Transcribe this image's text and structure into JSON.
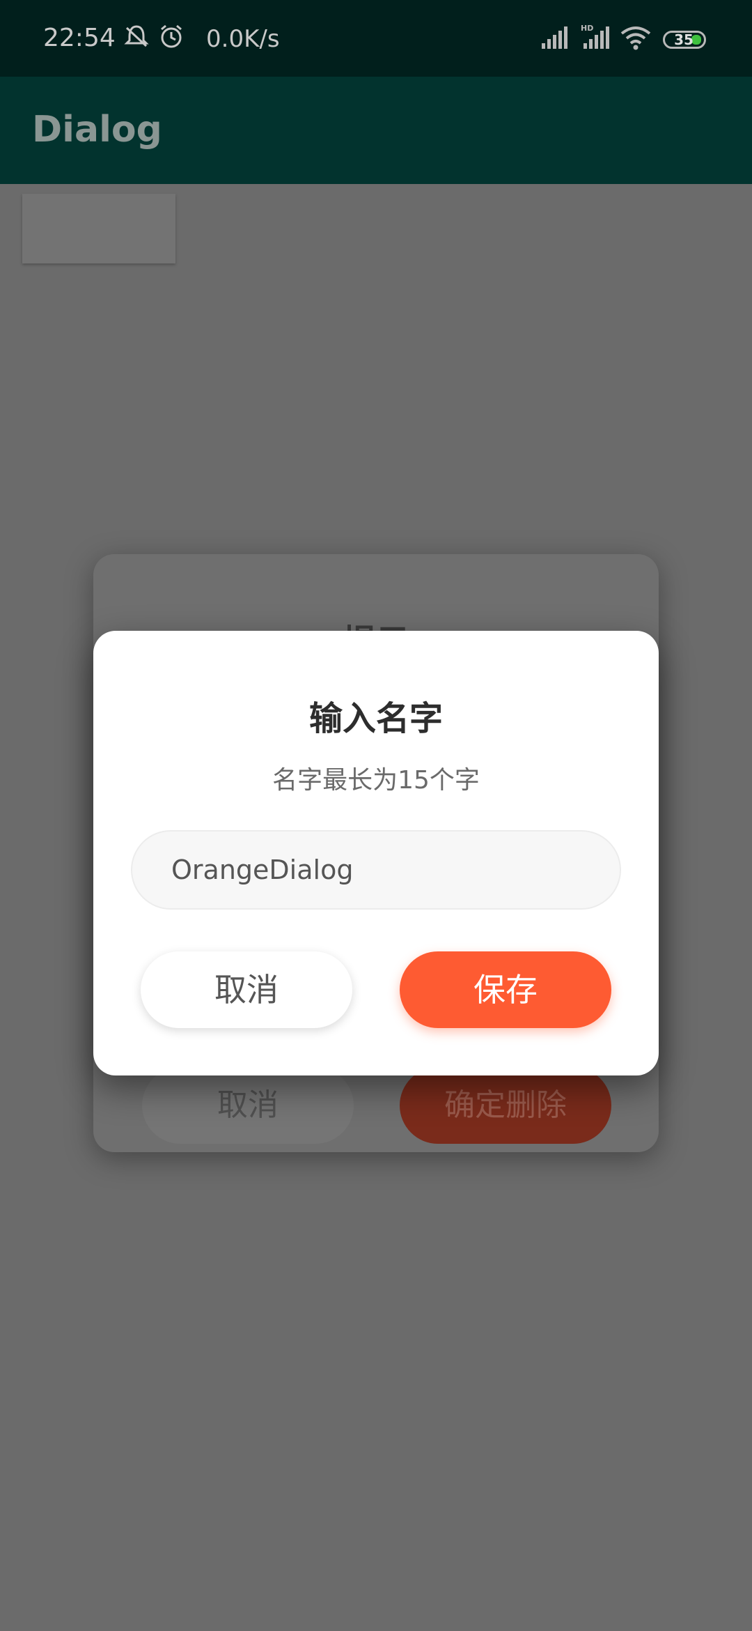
{
  "status_bar": {
    "time": "22:54",
    "net_speed": "0.0K/s",
    "battery_level": "35",
    "icons": [
      "bell-off-icon",
      "alarm-icon",
      "signal-icon",
      "signal-hd-icon",
      "wifi-icon",
      "battery-icon"
    ]
  },
  "app_bar": {
    "title": "Dialog"
  },
  "background_dialog": {
    "title": "提示",
    "cancel_label": "取消",
    "confirm_label": "确定删除"
  },
  "dialog": {
    "title": "输入名字",
    "subtitle": "名字最长为15个字",
    "input_value": "OrangeDialog",
    "cancel_label": "取消",
    "save_label": "保存"
  },
  "colors": {
    "status_bar": "#011f1c",
    "app_bar": "#02332e",
    "scrim": "#6b6b6b",
    "save_button": "#fe5b32"
  }
}
